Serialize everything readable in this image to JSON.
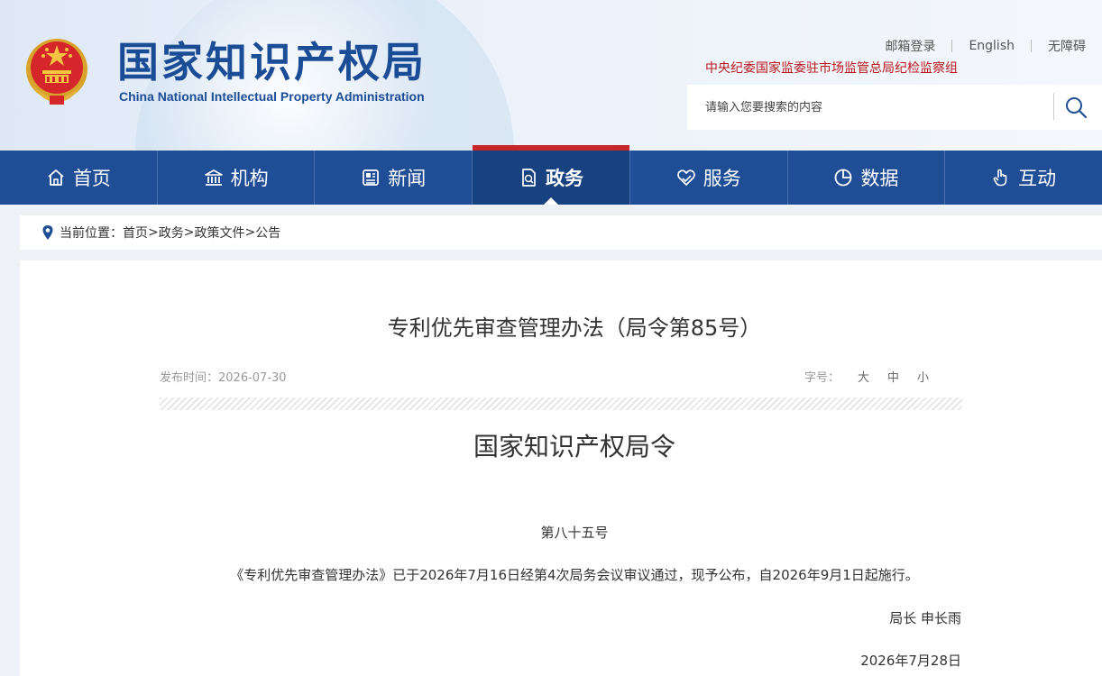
{
  "header": {
    "title": "国家知识产权局",
    "subtitle": "China National Intellectual Property Administration",
    "top_links": [
      {
        "label": "邮箱登录"
      },
      {
        "label": "English"
      },
      {
        "label": "无障碍"
      }
    ],
    "discipline_text": "中央纪委国家监委驻市场监管总局纪检监察组",
    "search": {
      "placeholder": "请输入您要搜索的内容",
      "icon": "search-icon"
    }
  },
  "nav": {
    "items": [
      {
        "label": "首页",
        "icon": "home-icon"
      },
      {
        "label": "机构",
        "icon": "institution-icon"
      },
      {
        "label": "新闻",
        "icon": "news-icon"
      },
      {
        "label": "政务",
        "icon": "document-icon",
        "active": true
      },
      {
        "label": "服务",
        "icon": "service-icon"
      },
      {
        "label": "数据",
        "icon": "pie-chart-icon"
      },
      {
        "label": "互动",
        "icon": "hand-icon"
      }
    ]
  },
  "breadcrumb": {
    "prefix": "当前位置：",
    "items": [
      "首页",
      "政务",
      "政策文件",
      "公告"
    ],
    "separator": ">"
  },
  "article": {
    "title": "专利优先审查管理办法（局令第85号）",
    "publish_label": "发布时间：",
    "publish_date": "2026-07-30",
    "font_size_label": "字号：",
    "font_sizes": [
      "大",
      "中",
      "小"
    ],
    "order_heading": "国家知识产权局令",
    "order_number": "第八十五号",
    "paragraph": "《专利优先审查管理办法》已于2026年7月16日经第4次局务会议审议通过，现予公布，自2026年9月1日起施行。",
    "signature": "局长 申长雨",
    "date": "2026年7月28日"
  },
  "colors": {
    "brand_blue": "#1f4e97",
    "active_red": "#c9262c",
    "discipline_red": "#b8181b"
  }
}
